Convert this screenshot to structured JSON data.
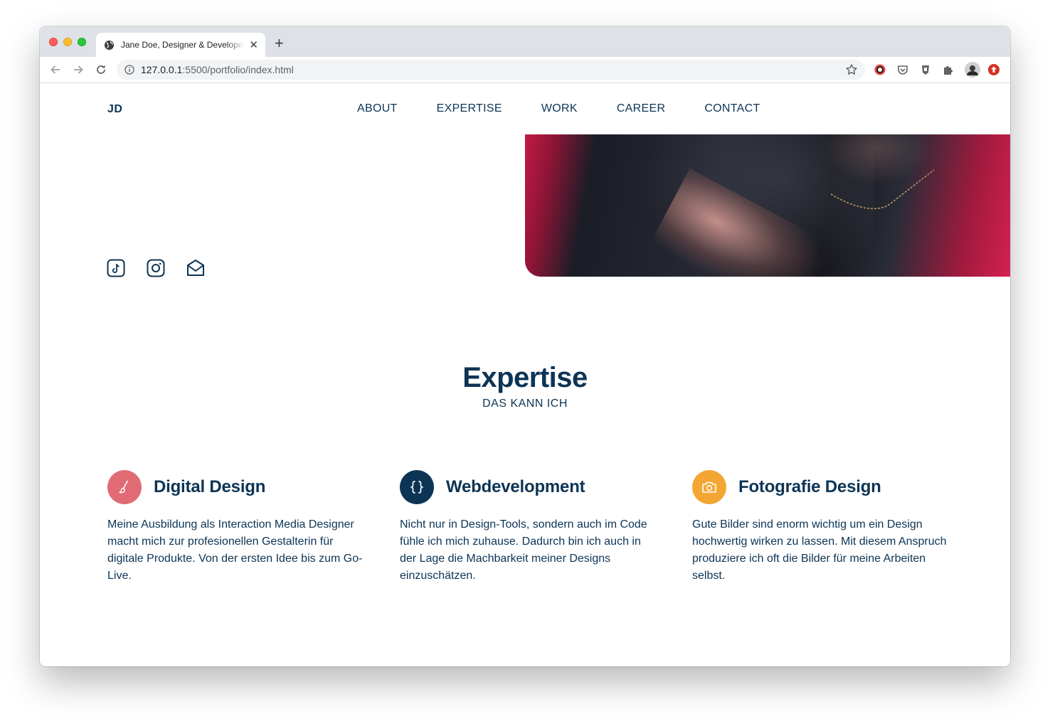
{
  "browser": {
    "tab_title": "Jane Doe, Designer & Developer",
    "tab_close": "✕",
    "new_tab": "+",
    "url_host": "127.0.0.1",
    "url_path": ":5500/portfolio/index.html"
  },
  "site": {
    "logo": "JD",
    "nav": [
      "ABOUT",
      "EXPERTISE",
      "WORK",
      "CAREER",
      "CONTACT"
    ],
    "social_icons": [
      "tiktok-icon",
      "instagram-icon",
      "mail-icon"
    ],
    "expertise": {
      "title": "Expertise",
      "subtitle": "DAS KANN ICH",
      "items": [
        {
          "icon": "brush-icon",
          "icon_color": "#e16b75",
          "title": "Digital Design",
          "text": "Meine Ausbildung als Interaction Media Designer macht mich zur profesionellen Gestalterin für digitale Produkte. Von der ersten Idee bis zum Go-Live."
        },
        {
          "icon": "code-braces-icon",
          "icon_color": "#0c3455",
          "title": "Webdevelopment",
          "text": "Nicht nur in Design-Tools, sondern auch im Code fühle ich mich zuhause. Dadurch bin ich auch in der Lage die Machbarkeit meiner Designs einzuschätzen."
        },
        {
          "icon": "camera-icon",
          "icon_color": "#f4a633",
          "title": "Fotografie Design",
          "text": "Gute Bilder sind enorm wichtig um ein Design hochwertig wirken zu lassen. Mit diesem Anspruch produziere ich oft die Bilder für meine Arbeiten selbst."
        }
      ]
    }
  },
  "colors": {
    "primary": "#0c3455",
    "accent_red": "#e16b75",
    "accent_orange": "#f4a633"
  }
}
